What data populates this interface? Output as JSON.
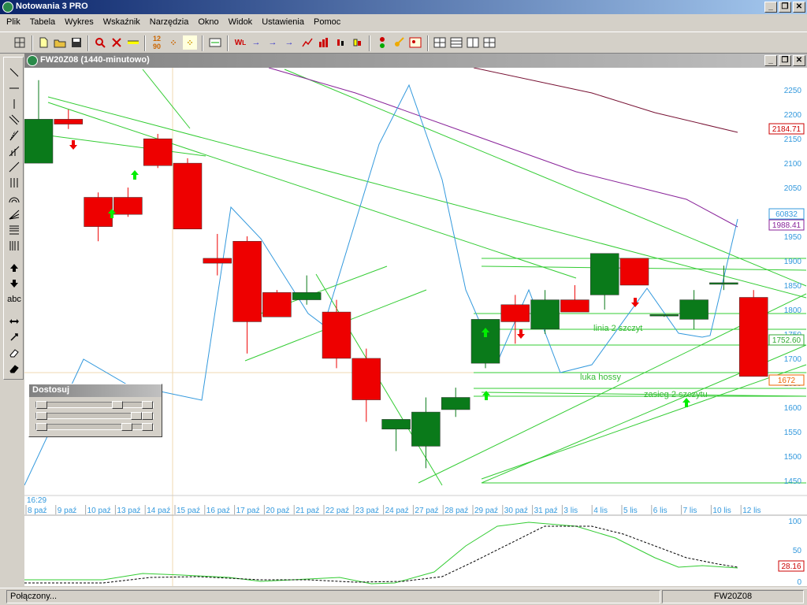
{
  "app": {
    "title": "Notowania 3 PRO"
  },
  "menu": [
    "Plik",
    "Tabela",
    "Wykres",
    "Wskaźnik",
    "Narzędzia",
    "Okno",
    "Widok",
    "Ustawienia",
    "Pomoc"
  ],
  "toolbar_icons": [
    "grid-icon",
    "new-file-icon",
    "open-folder-icon",
    "save-icon",
    "zoom-icon",
    "delete-icon",
    "ruler-icon",
    "numbers-icon",
    "dots-icon",
    "dots-yellow-icon",
    "indicator-icon",
    "wl-icon",
    "arrow-right-icon",
    "arrow-right-icon",
    "arrow-right-icon",
    "line-chart-icon",
    "bar-chart-icon",
    "candle-icon",
    "traffic-light-icon",
    "key-icon",
    "image-icon",
    "layout-1-icon",
    "layout-2-icon",
    "layout-3-icon",
    "layout-4-icon"
  ],
  "left_tools": [
    "line-diagonal-icon",
    "line-horizontal-icon",
    "line-vertical-icon",
    "channel-icon",
    "fan-icon",
    "gann-icon",
    "trend-icon",
    "triple-line-icon",
    "arc-icon",
    "speed-lines-icon",
    "fibonacci-icon",
    "time-zones-icon",
    "arrow-up-icon",
    "arrow-down-icon",
    "text-tool-icon",
    "resize-h-icon",
    "resize-icon",
    "eraser-icon",
    "eraser-all-icon"
  ],
  "left_tools_text": {
    "abc": "abc"
  },
  "chart_window": {
    "title": "FW20Z08 (1440-minutowo)"
  },
  "dialog": {
    "title": "Dostosuj"
  },
  "status": {
    "left": "Połączony...",
    "right": "FW20Z08"
  },
  "colors": {
    "up": "#0a7a1a",
    "down": "#ee0000",
    "line": "#3399dd",
    "support": "#33cc33",
    "ma": "#882299",
    "grid": "#f0d8b0"
  },
  "chart_data": {
    "type": "candlestick",
    "time_label": "16:29",
    "x": [
      "8 paź",
      "9 paź",
      "10 paź",
      "13 paź",
      "14 paź",
      "15 paź",
      "16 paź",
      "17 paź",
      "20 paź",
      "21 paź",
      "22 paź",
      "23 paź",
      "24 paź",
      "27 paź",
      "28 paź",
      "29 paź",
      "30 paź",
      "31 paź",
      "3 lis",
      "4 lis",
      "5 lis",
      "6 lis",
      "7 lis",
      "10 lis",
      "12 lis"
    ],
    "yticks": [
      2250,
      2200,
      2150,
      2100,
      2050,
      2000,
      1950,
      1900,
      1850,
      1800,
      1750,
      1700,
      1650,
      1600,
      1550,
      1500,
      1450
    ],
    "ylim": [
      1440,
      2260
    ],
    "candles": [
      {
        "d": "8 paź",
        "o": 2100,
        "h": 2270,
        "l": 2100,
        "c": 2190
      },
      {
        "d": "9 paź",
        "o": 2190,
        "h": 2210,
        "l": 2170,
        "c": 2180
      },
      {
        "d": "10 paź",
        "o": 2030,
        "h": 2040,
        "l": 1940,
        "c": 1970
      },
      {
        "d": "13 paź",
        "o": 2030,
        "h": 2050,
        "l": 1990,
        "c": 1995
      },
      {
        "d": "14 paź",
        "o": 2150,
        "h": 2160,
        "l": 2090,
        "c": 2095
      },
      {
        "d": "15 paź",
        "o": 2100,
        "h": 2110,
        "l": 1965,
        "c": 1965
      },
      {
        "d": "16 paź",
        "o": 1905,
        "h": 1955,
        "l": 1870,
        "c": 1895
      },
      {
        "d": "17 paź",
        "o": 1940,
        "h": 1950,
        "l": 1710,
        "c": 1775
      },
      {
        "d": "20 paź",
        "o": 1835,
        "h": 1840,
        "l": 1790,
        "c": 1785
      },
      {
        "d": "21 paź",
        "o": 1820,
        "h": 1870,
        "l": 1810,
        "c": 1835
      },
      {
        "d": "22 paź",
        "o": 1795,
        "h": 1820,
        "l": 1680,
        "c": 1700
      },
      {
        "d": "23 paź",
        "o": 1700,
        "h": 1720,
        "l": 1570,
        "c": 1615
      },
      {
        "d": "24 paź",
        "o": 1555,
        "h": 1575,
        "l": 1510,
        "c": 1575
      },
      {
        "d": "27 paź",
        "o": 1520,
        "h": 1620,
        "l": 1475,
        "c": 1590
      },
      {
        "d": "28 paź",
        "o": 1595,
        "h": 1640,
        "l": 1580,
        "c": 1620
      },
      {
        "d": "29 paź",
        "o": 1690,
        "h": 1780,
        "l": 1680,
        "c": 1780
      },
      {
        "d": "30 paź",
        "o": 1810,
        "h": 1830,
        "l": 1730,
        "c": 1775
      },
      {
        "d": "31 paź",
        "o": 1760,
        "h": 1840,
        "l": 1750,
        "c": 1820
      },
      {
        "d": "3 lis",
        "o": 1820,
        "h": 1850,
        "l": 1800,
        "c": 1795
      },
      {
        "d": "4 lis",
        "o": 1830,
        "h": 1915,
        "l": 1800,
        "c": 1915
      },
      {
        "d": "5 lis",
        "o": 1905,
        "h": 1905,
        "l": 1850,
        "c": 1850
      },
      {
        "d": "6 lis",
        "o": 1790,
        "h": 1790,
        "l": 1785,
        "c": 1790
      },
      {
        "d": "7 lis",
        "o": 1780,
        "h": 1840,
        "l": 1760,
        "c": 1820
      },
      {
        "d": "10 lis",
        "o": 1855,
        "h": 1890,
        "l": 1840,
        "c": 1855
      },
      {
        "d": "12 lis",
        "o": 1825,
        "h": 1840,
        "l": 1663,
        "c": 1663
      }
    ],
    "price_labels": [
      {
        "v": "2184.71",
        "color": "#cc0000"
      },
      {
        "v": "60832",
        "color": "#3399dd"
      },
      {
        "v": "1988.41",
        "color": "#882299"
      },
      {
        "v": "1752.60",
        "color": "#33aa33"
      },
      {
        "v": "1672",
        "color": "#ee6600"
      }
    ],
    "annotations": [
      "linia 2 szczyt",
      "luka hossy",
      "zasieg 2 szczytu"
    ],
    "oscillator": {
      "yticks": [
        100,
        50,
        0
      ],
      "last": "28.16"
    }
  }
}
